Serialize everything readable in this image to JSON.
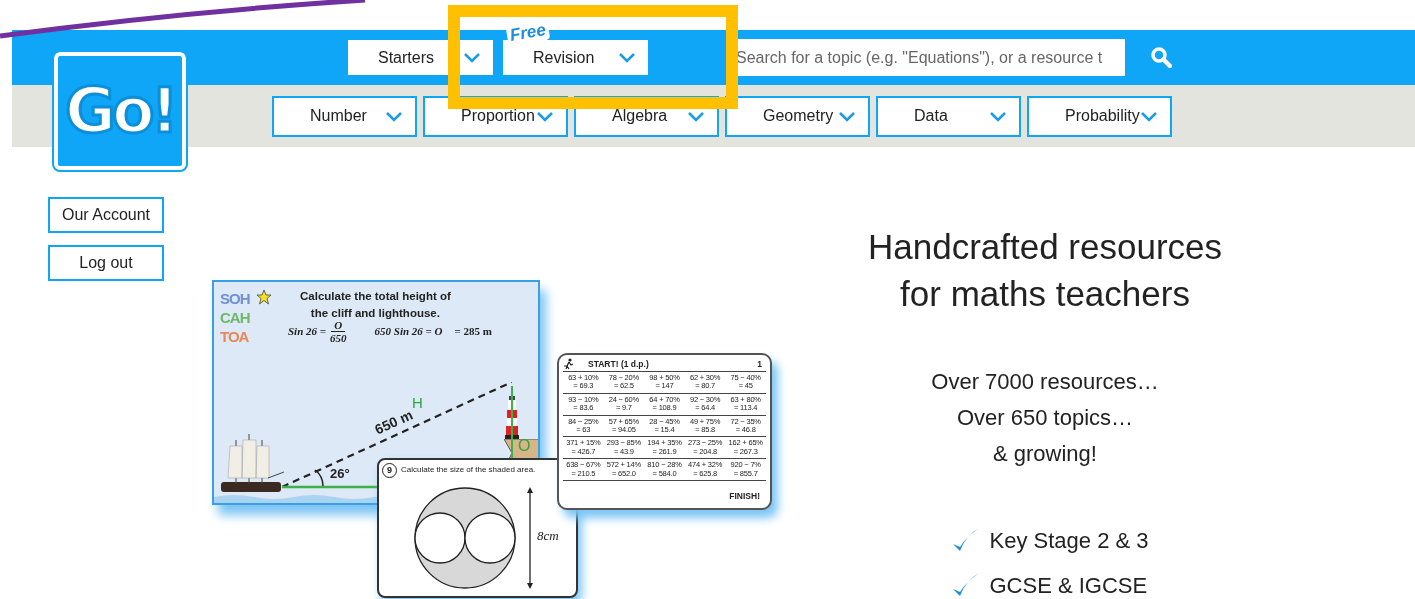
{
  "annotations": {
    "pen_stroke": true,
    "highlight_frame": true
  },
  "logo": {
    "text": "Go!"
  },
  "top_menus": [
    {
      "label": "Starters"
    },
    {
      "label": "Revision",
      "tag": "Free"
    }
  ],
  "search": {
    "placeholder": "Search for a topic (e.g. \"Equations\"), or a resource t"
  },
  "topic_menus": [
    {
      "label": "Number"
    },
    {
      "label": "Proportion"
    },
    {
      "label": "Algebra"
    },
    {
      "label": "Geometry"
    },
    {
      "label": "Data"
    },
    {
      "label": "Probability"
    }
  ],
  "account_links": [
    {
      "label": "Our Account"
    },
    {
      "label": "Log out"
    }
  ],
  "trig_card": {
    "mnemonic": [
      {
        "text": "SOH",
        "color": "#6f8fd6"
      },
      {
        "text": "CAH",
        "color": "#6fb86a"
      },
      {
        "text": "TOA",
        "color": "#e8875a"
      }
    ],
    "title": [
      "Calculate the total height of",
      "the cliff and lighthouse."
    ],
    "equation_left": "Sin 26 =",
    "numerator": "O",
    "denominator": "650",
    "equation_middle": "650 Sin 26 = O",
    "result": "= 285 m",
    "hypotenuse": "650 m",
    "hypotenuse_label": "H",
    "opposite_label": "O",
    "angle": "26°"
  },
  "maze_card": {
    "start": "START! (1 d.p.)",
    "page": "1",
    "finish": "FINISH!",
    "cells": [
      {
        "sum": "63 + 10%",
        "answer": "= 69.3"
      },
      {
        "sum": "78 − 20%",
        "answer": "= 62.5"
      },
      {
        "sum": "98 + 50%",
        "answer": "= 147"
      },
      {
        "sum": "62 + 30%",
        "answer": "= 80.7"
      },
      {
        "sum": "75 − 40%",
        "answer": "= 45"
      },
      {
        "sum": "93 − 10%",
        "answer": "= 83.6"
      },
      {
        "sum": "24 − 60%",
        "answer": "= 9.7"
      },
      {
        "sum": "64 + 70%",
        "answer": "= 108.9"
      },
      {
        "sum": "92 − 30%",
        "answer": "= 64.4"
      },
      {
        "sum": "63 + 80%",
        "answer": "= 113.4"
      },
      {
        "sum": "84 − 25%",
        "answer": "= 63"
      },
      {
        "sum": "57 + 65%",
        "answer": "= 94.05"
      },
      {
        "sum": "28 − 45%",
        "answer": "= 15.4"
      },
      {
        "sum": "49 + 75%",
        "answer": "= 85.8"
      },
      {
        "sum": "72 − 35%",
        "answer": "= 46.8"
      },
      {
        "sum": "371 + 15%",
        "answer": "= 426.7"
      },
      {
        "sum": "293 − 85%",
        "answer": "= 43.9"
      },
      {
        "sum": "194 + 35%",
        "answer": "= 261.9"
      },
      {
        "sum": "273 − 25%",
        "answer": "= 204.8"
      },
      {
        "sum": "162 + 65%",
        "answer": "= 267.3"
      },
      {
        "sum": "638 − 67%",
        "answer": "= 210.5"
      },
      {
        "sum": "572 + 14%",
        "answer": "= 652.0"
      },
      {
        "sum": "810 − 28%",
        "answer": "= 584.0"
      },
      {
        "sum": "474 + 32%",
        "answer": "= 625.8"
      },
      {
        "sum": "920 − 7%",
        "answer": "= 855.7"
      }
    ]
  },
  "area_card": {
    "number": "9",
    "question": "Calculate the size of the shaded area.",
    "dimension": "8cm"
  },
  "headline": [
    "Handcrafted resources",
    "for maths teachers"
  ],
  "stats": [
    "Over 7000 resources…",
    "Over 650 topics…",
    "& growing!"
  ],
  "checklist": [
    "Key Stage 2 & 3",
    "GCSE & IGCSE"
  ]
}
